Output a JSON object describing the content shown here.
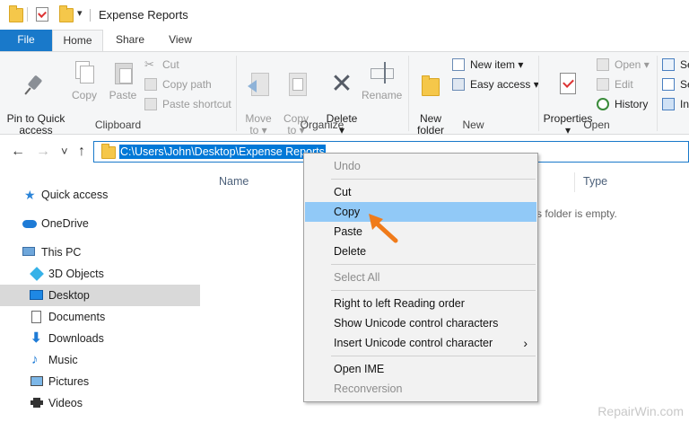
{
  "window": {
    "title": "Expense Reports"
  },
  "tabs": {
    "file": "File",
    "home": "Home",
    "share": "Share",
    "view": "View"
  },
  "ribbon": {
    "clipboard": {
      "label": "Clipboard",
      "pin": "Pin to Quick\naccess",
      "copy": "Copy",
      "paste": "Paste",
      "cut": "Cut",
      "copy_path": "Copy path",
      "paste_shortcut": "Paste shortcut"
    },
    "organize": {
      "label": "Organize",
      "move_to": "Move\nto ▾",
      "copy_to": "Copy\nto ▾",
      "delete": "Delete\n▾",
      "rename": "Rename"
    },
    "new": {
      "label": "New",
      "new_folder": "New\nfolder",
      "new_item": "New item ▾",
      "easy_access": "Easy access ▾"
    },
    "open": {
      "label": "Open",
      "properties": "Properties\n▾",
      "open": "Open ▾",
      "edit": "Edit",
      "history": "History"
    },
    "select": {
      "sel1": "Se",
      "sel2": "Se",
      "inv": "In"
    }
  },
  "address": {
    "path": "C:\\Users\\John\\Desktop\\Expense Reports"
  },
  "nav": {
    "back": "←",
    "forward": "→",
    "recent": "˅",
    "up": "↑",
    "items": [
      {
        "label": "Quick access"
      },
      {
        "label": "OneDrive"
      },
      {
        "label": "This PC"
      },
      {
        "label": "3D Objects"
      },
      {
        "label": "Desktop"
      },
      {
        "label": "Documents"
      },
      {
        "label": "Downloads"
      },
      {
        "label": "Music"
      },
      {
        "label": "Pictures"
      },
      {
        "label": "Videos"
      }
    ]
  },
  "content": {
    "col_name": "Name",
    "col_type": "Type",
    "empty": "s folder is empty."
  },
  "context_menu": {
    "undo": "Undo",
    "cut": "Cut",
    "copy": "Copy",
    "paste": "Paste",
    "delete": "Delete",
    "select_all": "Select All",
    "rtl": "Right to left Reading order",
    "show_unicode": "Show Unicode control characters",
    "insert_unicode": "Insert Unicode control character",
    "open_ime": "Open IME",
    "reconversion": "Reconversion",
    "submenu_arrow": "›"
  },
  "watermark": "RepairWin.com",
  "colors": {
    "accent": "#1979ca",
    "highlight": "#91c9f7",
    "selection": "#0078d7",
    "pointer": "#f07b1a"
  }
}
